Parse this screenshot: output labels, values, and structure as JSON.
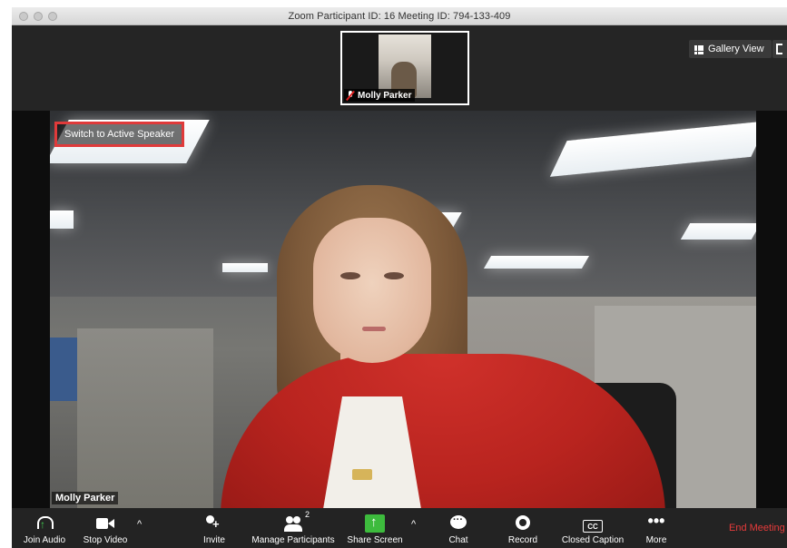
{
  "window": {
    "title": "Zoom Participant ID: 16   Meeting ID: 794-133-409"
  },
  "thumbnail": {
    "participant_name": "Molly Parker"
  },
  "view_controls": {
    "gallery_view_label": "Gallery View"
  },
  "video": {
    "switch_label": "Switch to Active Speaker",
    "speaker_name": "Molly Parker"
  },
  "toolbar": {
    "join_audio": "Join Audio",
    "stop_video": "Stop Video",
    "invite": "Invite",
    "manage_participants": "Manage Participants",
    "participant_count": "2",
    "share_screen": "Share Screen",
    "chat": "Chat",
    "record": "Record",
    "cc_glyph": "CC",
    "closed_caption": "Closed Caption",
    "more_glyph": "•••",
    "more": "More",
    "end_meeting": "End Meeting",
    "caret": "^"
  },
  "colors": {
    "accent_green": "#3dbb3d",
    "end_red": "#e63b3b",
    "highlight_red": "#e03a3a"
  }
}
